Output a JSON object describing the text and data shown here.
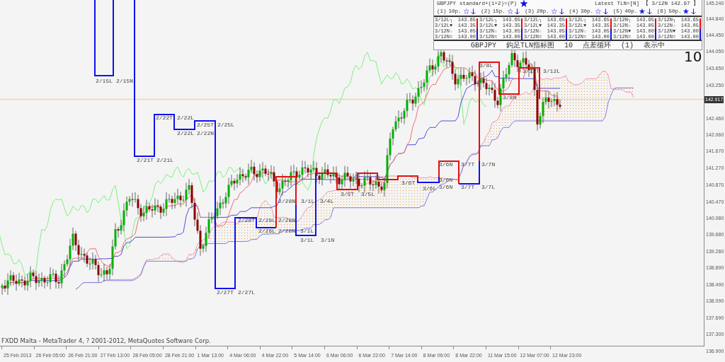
{
  "header": {
    "symbol": "GBPJPY",
    "mode": "standard+(1+2)=(P)",
    "mode_starred": true,
    "latest_label": "Latest TLN=[N]",
    "latest_value": "【 3/12N 142.97 】"
  },
  "settings": [
    {
      "number": "(1)",
      "period": "10p.",
      "starred": false
    },
    {
      "number": "(2)",
      "period": "15p.",
      "starred": false
    },
    {
      "number": "(3)",
      "period": "20p.",
      "starred": false
    },
    {
      "number": "(4)",
      "period": "30p.",
      "starred": false
    },
    {
      "number": "(5)",
      "period": "40p.",
      "starred": true
    },
    {
      "number": "(6)",
      "period": "50p.",
      "starred": true
    }
  ],
  "columns": [
    {
      "rows": [
        {
          "code": "3/12L┐",
          "price": "143.65"
        },
        {
          "code": "3/12L▼",
          "price": "143.35"
        },
        {
          "code": "3/12N☆",
          "price": "143.05"
        },
        {
          "code": "3/12N=",
          "price": "143.00"
        }
      ]
    },
    {
      "rows": [
        {
          "code": "3/12L┐",
          "price": "143.65"
        },
        {
          "code": "3/12L▼",
          "price": "143.35"
        },
        {
          "code": "3/12N☆",
          "price": "143.05"
        },
        {
          "code": "3/12N=",
          "price": "143.00"
        }
      ]
    },
    {
      "rows": [
        {
          "code": "3/12L┐",
          "price": "143.65"
        },
        {
          "code": "3/12L▼",
          "price": "143.35"
        },
        {
          "code": "3/12N☆",
          "price": "143.05"
        },
        {
          "code": "3/12N=",
          "price": "143.00"
        }
      ]
    },
    {
      "rows": [
        {
          "code": "3/12L┐",
          "price": "143.65"
        },
        {
          "code": "3/12L▼",
          "price": "143.35"
        },
        {
          "code": "3/12N☆",
          "price": "143.05"
        },
        {
          "code": "3/12N=",
          "price": "143.00"
        }
      ]
    },
    {
      "rows": [
        {
          "code": "3/12N┐",
          "price": "143.65"
        },
        {
          "code": "3/12N☆",
          "price": "143.05"
        },
        {
          "code": "3/12N▼",
          "price": "143.00"
        },
        {
          "code": "3/12N=",
          "price": "143.00"
        }
      ]
    },
    {
      "rows": [
        {
          "code": "3/12N┐",
          "price": "143.65"
        },
        {
          "code": "3/12N☆",
          "price": "143.05"
        },
        {
          "code": "3/12N▼",
          "price": "143.00"
        },
        {
          "code": "3/12N=",
          "price": "143.00"
        }
      ]
    }
  ],
  "footer": {
    "symbol": "GBPJPY",
    "title": "鈎足TLN指标图",
    "count": "10",
    "mode": "点差循环",
    "index": "(1)",
    "status": "表示中"
  },
  "big_number": "10",
  "current_price": "142.917",
  "price_ticks": [
    "145.240",
    "144.840",
    "144.450",
    "144.050",
    "143.650",
    "143.250",
    "142.460",
    "142.060",
    "141.670",
    "141.270",
    "140.870",
    "140.470",
    "140.080",
    "139.680",
    "139.280",
    "138.890",
    "138.490",
    "138.090",
    "137.690",
    "137.300",
    "136.900"
  ],
  "time_ticks": [
    "25 Feb 2013",
    "26 Feb 05:00",
    "26 Feb 21:00",
    "27 Feb 13:00",
    "28 Feb 05:00",
    "28 Feb 21:00",
    "1 Mar 13:00",
    "4 Mar 06:00",
    "4 Mar 22:00",
    "5 Mar 14:00",
    "6 Mar 06:00",
    "6 Mar 22:00",
    "7 Mar 14:00",
    "8 Mar 06:00",
    "8 Mar 22:00",
    "11 Mar 15:00",
    "12 Mar 07:00",
    "12 Mar 23:00"
  ],
  "copyright": "FXDD Malta - MetaTrader 4, ? 2001-2012, MetaQuotes Software Corp.",
  "tln_labels": [
    "2/15L",
    "2/15N",
    "2/22T",
    "2/22L",
    "2/25T",
    "2/25L",
    "2/22L",
    "2/22N",
    "2/21T",
    "2/21L",
    "2/28N",
    "3/1L",
    "3/4L",
    "2/28T",
    "2/28L",
    "2/28N",
    "2/28L",
    "2/28N",
    "3/1L",
    "3/1L",
    "3/1N",
    "2/27T",
    "2/27L",
    "3/8L",
    "3/12T",
    "3/12L",
    "3/8N",
    "3/6N",
    "3/7T",
    "3/7N",
    "3/6N",
    "3/6N",
    "3/7T",
    "3/7L",
    "3/5T",
    "3/5L",
    "3/6T",
    "3/6L"
  ]
}
